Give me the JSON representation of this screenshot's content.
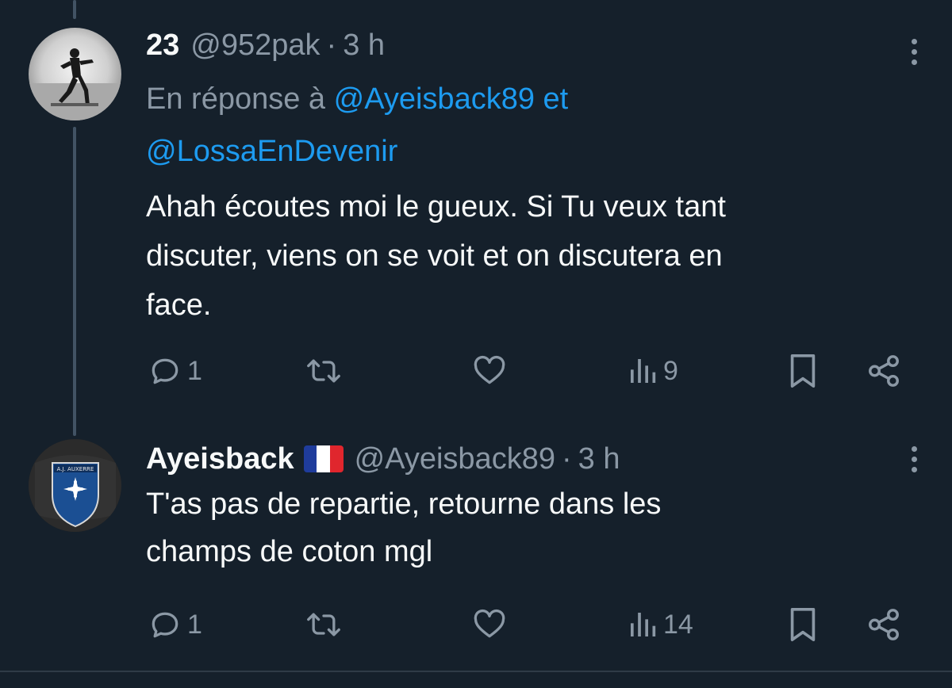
{
  "tweets": [
    {
      "name": "23",
      "handle": "@952pak",
      "separator": "·",
      "time": "3 h",
      "reply_prefix": "En réponse à",
      "reply_user1": "@Ayeisback89",
      "reply_connector": "et",
      "reply_user2": "@LossaEnDevenir",
      "body_lines": [
        "Ahah écoutes moi le gueux. Si Tu veux tant",
        "discuter, viens on se voit et on discutera en",
        "face."
      ],
      "replies": "1",
      "views": "9",
      "icons": [
        "comment-icon",
        "retweet-icon",
        "like-icon",
        "views-icon",
        "bookmark-icon",
        "share-icon",
        "more-icon"
      ]
    },
    {
      "name": "Ayeisback",
      "handle": "@Ayeisback89",
      "separator": "·",
      "time": "3 h",
      "flag": "france-flag",
      "body_lines": [
        "T'as pas de repartie, retourne dans les",
        "champs de coton mgl"
      ],
      "replies": "1",
      "views": "14",
      "icons": [
        "comment-icon",
        "retweet-icon",
        "like-icon",
        "views-icon",
        "bookmark-icon",
        "share-icon",
        "more-icon"
      ]
    }
  ],
  "colors": {
    "background": "#15202b",
    "text_primary": "#f7f9f9",
    "text_secondary": "#8b98a5",
    "link": "#1d9bf0",
    "thread_line": "#425364"
  }
}
